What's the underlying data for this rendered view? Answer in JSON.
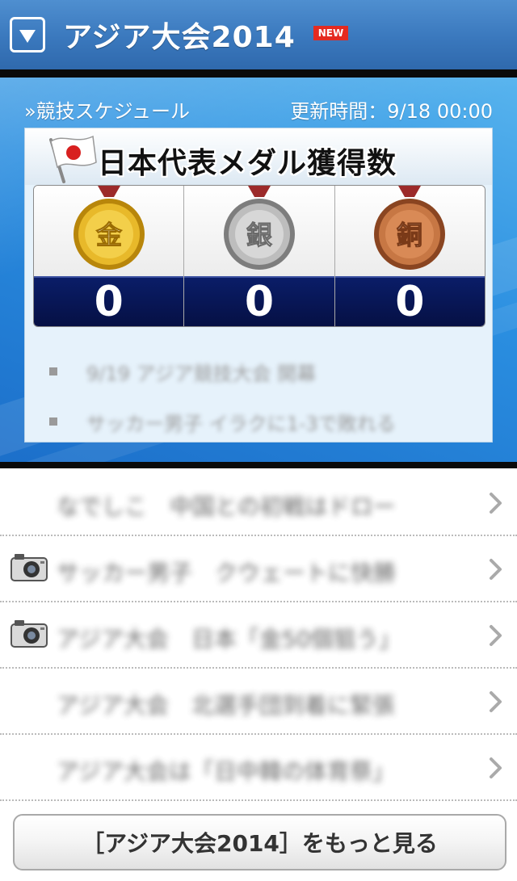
{
  "header": {
    "title": "アジア大会2014",
    "badge": "NEW"
  },
  "schedule": {
    "link_label": "»競技スケジュール",
    "updated_label": "更新時間：9/18 00:00"
  },
  "medal_card": {
    "title": "日本代表メダル獲得数",
    "medals": [
      {
        "kanji": "金",
        "count": "0",
        "color": "#d6a31d"
      },
      {
        "kanji": "銀",
        "count": "0",
        "color": "#a8a8a8"
      },
      {
        "kanji": "銅",
        "count": "0",
        "color": "#b9683a"
      }
    ],
    "news": [
      {
        "text": "9/19 アジア競技大会 開幕"
      },
      {
        "text": "サッカー男子 イラクに1-3で敗れる"
      }
    ]
  },
  "articles": [
    {
      "text": "なでしこ　中国との初戦はドロー",
      "has_photo": false
    },
    {
      "text": "サッカー男子　クウェートに快勝",
      "has_photo": true
    },
    {
      "text": "アジア大会　日本「金50個狙う」",
      "has_photo": true
    },
    {
      "text": "アジア大会　北選手団到着に緊張",
      "has_photo": false
    },
    {
      "text": "アジア大会は「日中韓の体育祭」",
      "has_photo": false
    }
  ],
  "more_button": {
    "label": "［アジア大会2014］をもっと見る"
  }
}
